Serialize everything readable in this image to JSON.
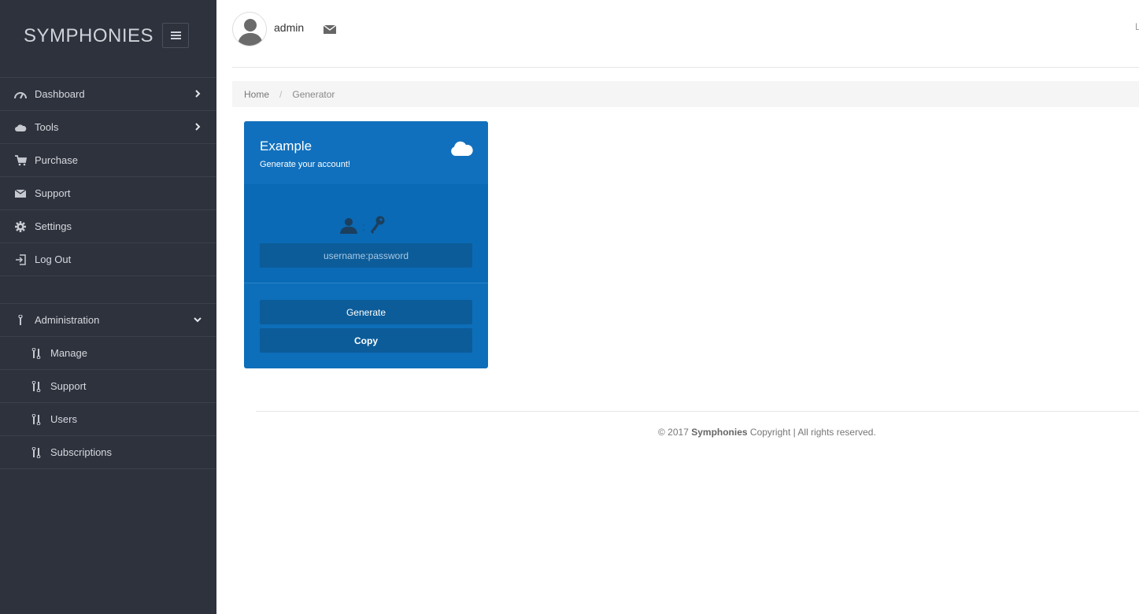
{
  "brand": {
    "title": "SYMPHONIES"
  },
  "sidebar": {
    "items": [
      {
        "label": "Dashboard",
        "icon": "dashboard-gauge-icon",
        "has_chevron": true
      },
      {
        "label": "Tools",
        "icon": "cloud-icon",
        "has_chevron": true
      },
      {
        "label": "Purchase",
        "icon": "cart-icon"
      },
      {
        "label": "Support",
        "icon": "envelope-icon"
      },
      {
        "label": "Settings",
        "icon": "gear-icon"
      },
      {
        "label": "Log Out",
        "icon": "logout-icon"
      }
    ],
    "admin": {
      "label": "Administration",
      "icon": "wrench-icon",
      "expanded": true,
      "items": [
        {
          "label": "Manage",
          "icon": "tools-icon"
        },
        {
          "label": "Support",
          "icon": "tools-icon"
        },
        {
          "label": "Users",
          "icon": "tools-icon"
        },
        {
          "label": "Subscriptions",
          "icon": "tools-icon"
        }
      ]
    }
  },
  "topbar": {
    "user_name": "admin",
    "right_text": "L"
  },
  "breadcrumb": {
    "home": "Home",
    "separator": "/",
    "current": "Generator"
  },
  "card": {
    "title": "Example",
    "subtitle": "Generate your account!",
    "credentials_separator": ":",
    "credentials_value": "username:password",
    "generate_label": "Generate",
    "copy_label": "Copy",
    "accent_color": "#0d6eb9"
  },
  "footer": {
    "prefix": "© 2017",
    "brand": "Symphonies",
    "suffix": "Copyright | All rights reserved."
  },
  "colors": {
    "sidebar_bg": "#2e323d",
    "card_bg": "#0d6eb9",
    "button_bg": "#0c5c99"
  }
}
